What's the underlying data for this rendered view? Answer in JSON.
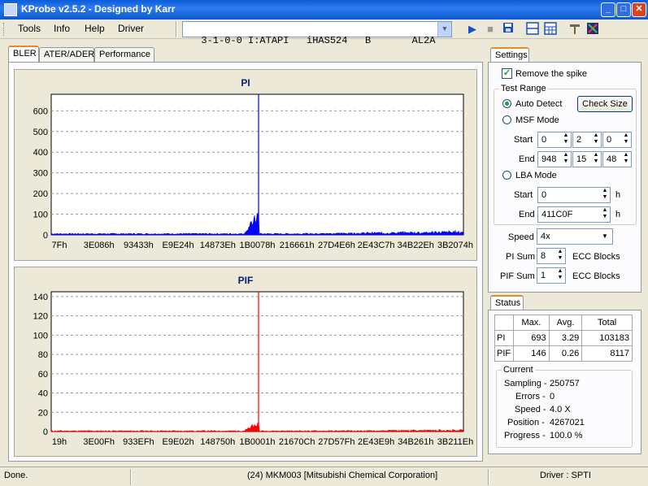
{
  "window": {
    "title": "KProbe v2.5.2 - Designed by Karr",
    "buttons": [
      "_",
      "□",
      "✕"
    ]
  },
  "menu": [
    "Tools",
    "Info",
    "Help",
    "Driver"
  ],
  "drive": {
    "selected": "3-1-0-0 I:ATAPI   iHAS524   B       AL2A"
  },
  "toolbar": {
    "icons": [
      "play-icon",
      "stop-icon",
      "save-icon",
      "split-view-icon",
      "grid-view-icon",
      "settings-tools-icon",
      "eject-icon"
    ]
  },
  "tabs": [
    "BLER",
    "ATER/ADER",
    "Performance"
  ],
  "charts": {
    "pi": {
      "title": "PI",
      "yticks": [
        "600",
        "500",
        "400",
        "300",
        "200",
        "100",
        "0"
      ],
      "xticks": [
        "7Fh",
        "3E086h",
        "93433h",
        "E9E24h",
        "14873Eh",
        "1B0078h",
        "216661h",
        "27D4E6h",
        "2E43C7h",
        "34B22Eh",
        "3B2074h"
      ]
    },
    "pif": {
      "title": "PIF",
      "yticks": [
        "140",
        "120",
        "100",
        "80",
        "60",
        "40",
        "20",
        "0"
      ],
      "xticks": [
        "19h",
        "3E00Fh",
        "933EFh",
        "E9E02h",
        "148750h",
        "1B0001h",
        "21670Ch",
        "27D57Fh",
        "2E43E9h",
        "34B261h",
        "3B211Eh"
      ]
    }
  },
  "chart_data": [
    {
      "type": "area",
      "title": "PI",
      "ylim": [
        0,
        680
      ],
      "x_range_note": "LBA hex 7Fh to ~411C0Fh",
      "series": [
        {
          "name": "PI",
          "color": "#0000ff",
          "peak": 693,
          "avg": 3.29,
          "total": 103183
        }
      ],
      "grid": true
    },
    {
      "type": "area",
      "title": "PIF",
      "ylim": [
        0,
        145
      ],
      "series": [
        {
          "name": "PIF",
          "color": "#ff0000",
          "peak": 146,
          "avg": 0.26,
          "total": 8117
        }
      ],
      "grid": true
    }
  ],
  "settings": {
    "tab": "Settings",
    "remove_spike": {
      "label": "Remove the spike",
      "checked": true
    },
    "test_range": "Test Range",
    "auto_detect": "Auto Detect",
    "check_size": "Check Size",
    "msf_mode": "MSF Mode",
    "msf_start_label": "Start",
    "msf_start": [
      "0",
      "2",
      "0"
    ],
    "msf_end_label": "End",
    "msf_end": [
      "948",
      "15",
      "48"
    ],
    "lba_mode": "LBA Mode",
    "lba_start_label": "Start",
    "lba_start": "0",
    "lba_end_label": "End",
    "lba_end": "411C0F",
    "h": "h",
    "speed_label": "Speed",
    "speed": "4x",
    "pi_sum_label": "PI Sum",
    "pi_sum": "8",
    "pif_sum_label": "PIF Sum",
    "pif_sum": "1",
    "ecc_blocks": "ECC Blocks"
  },
  "status": {
    "tab": "Status",
    "headers": [
      "Max.",
      "Avg.",
      "Total"
    ],
    "rows": [
      {
        "label": "PI",
        "max": "693",
        "avg": "3.29",
        "total": "103183"
      },
      {
        "label": "PIF",
        "max": "146",
        "avg": "0.26",
        "total": "8117"
      }
    ],
    "current": "Current",
    "sampling_label": "Sampling -",
    "sampling": "250757",
    "errors_label": "Errors -",
    "errors": "0",
    "speed_label": "Speed -",
    "speed": "4.0  X",
    "position_label": "Position -",
    "position": "4267021",
    "progress_label": "Progress -",
    "progress": "100.0 %"
  },
  "statusbar": {
    "left": "Done.",
    "center": "(24) MKM003 [Mitsubishi Chemical Corporation]",
    "right": "Driver : SPTI"
  }
}
